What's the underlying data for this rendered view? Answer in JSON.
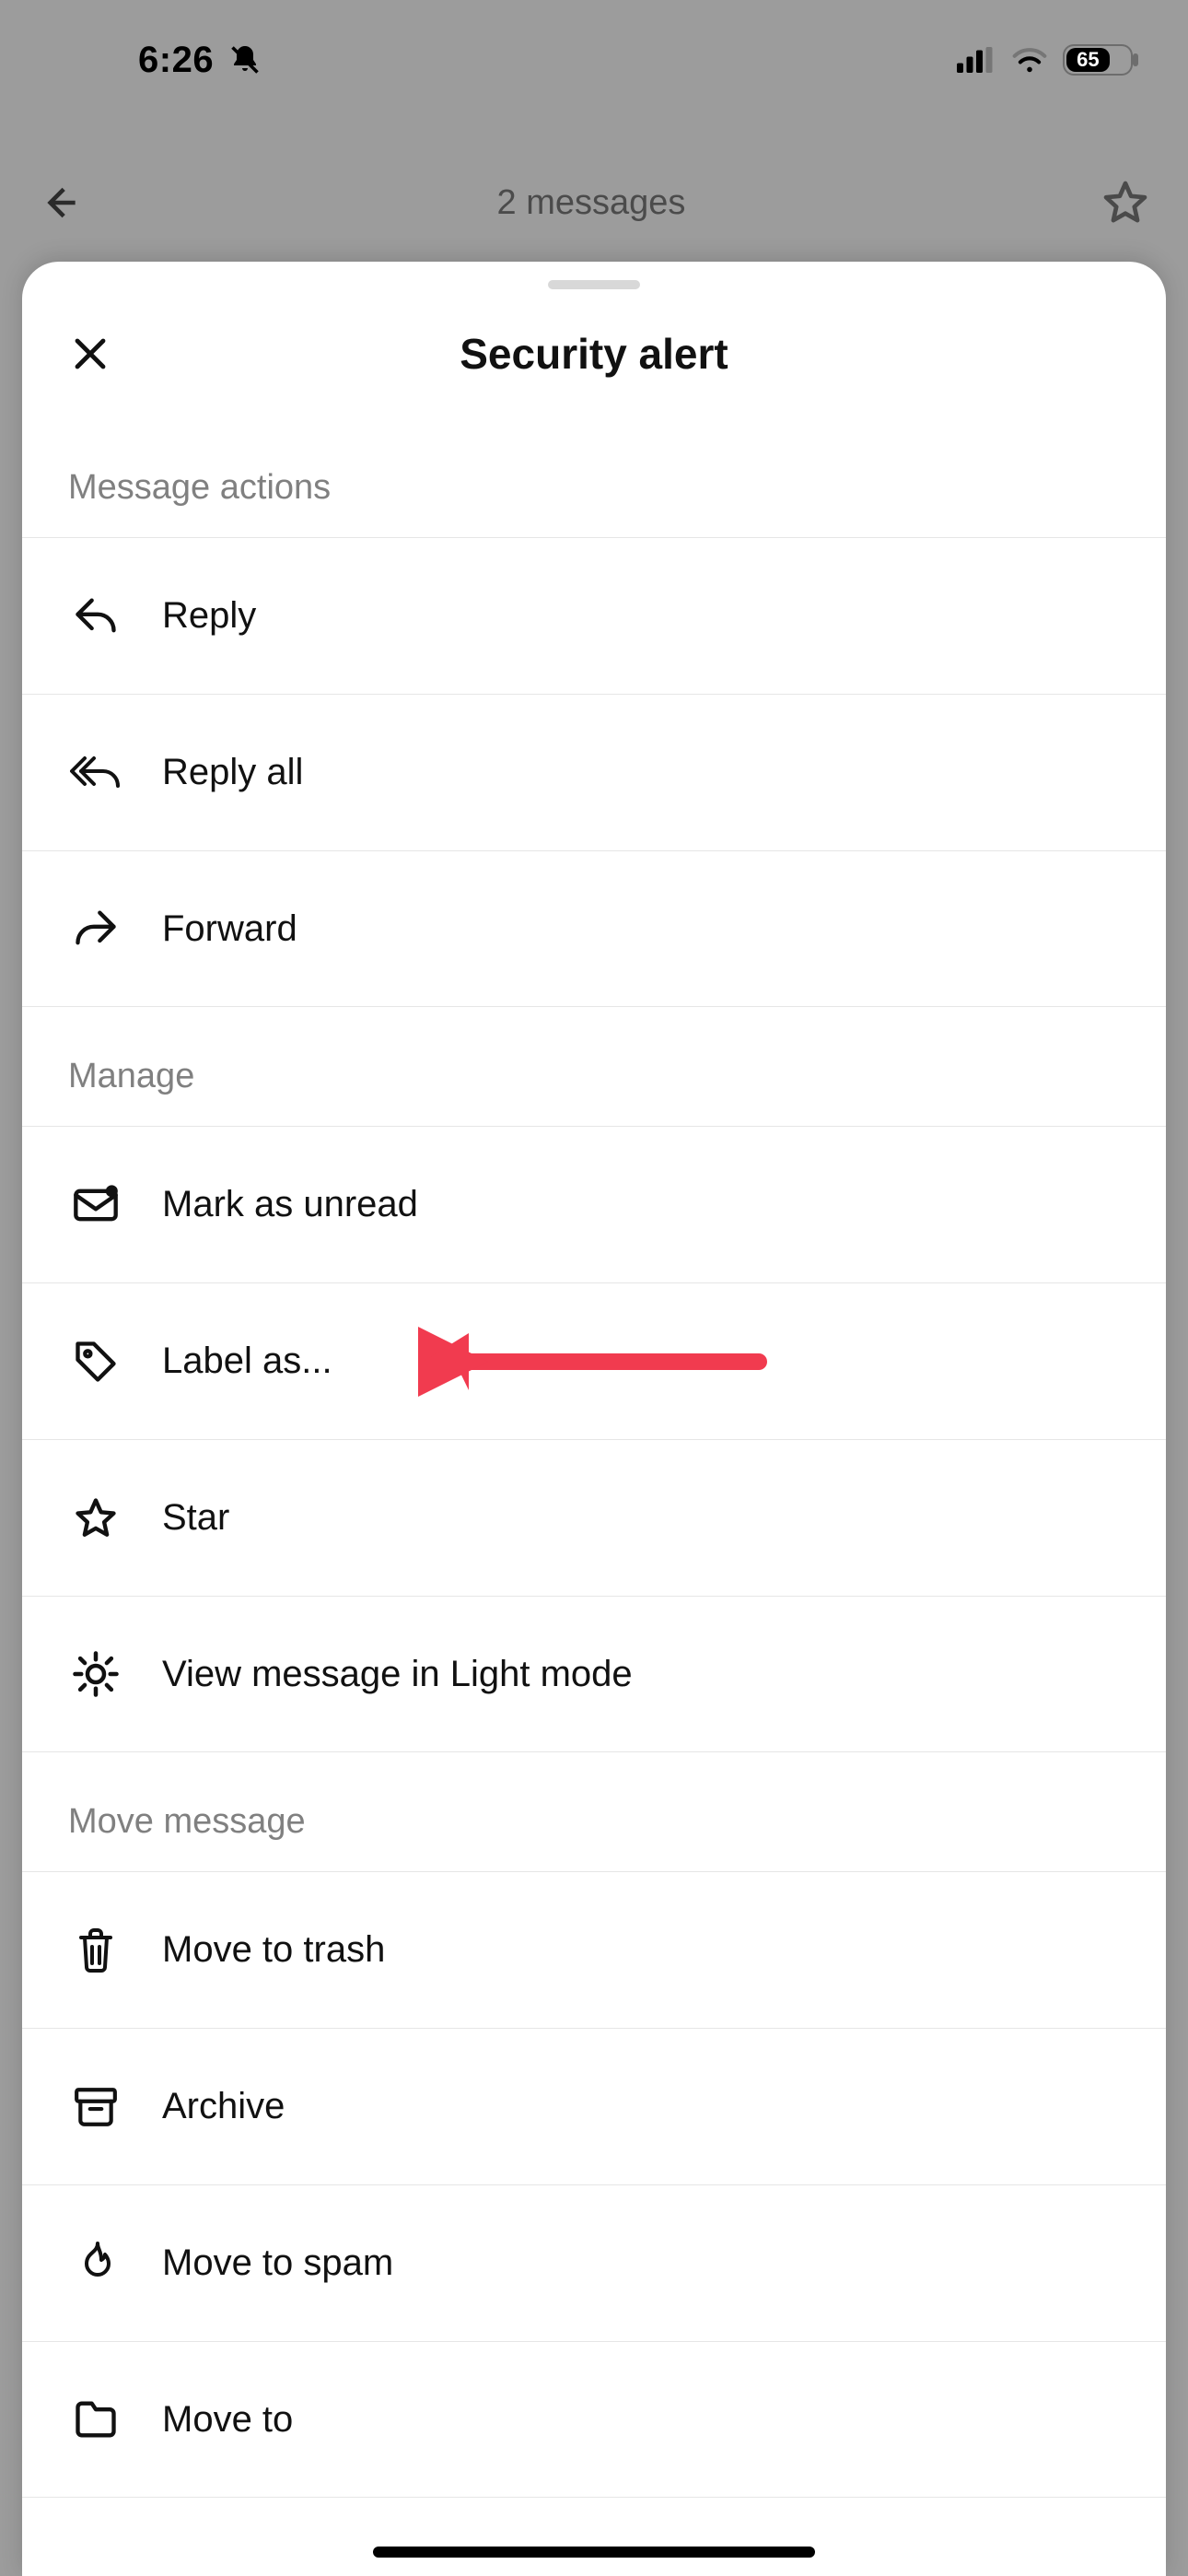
{
  "status_bar": {
    "time": "6:26",
    "battery_percent": "65"
  },
  "nav": {
    "title": "2 messages"
  },
  "sheet": {
    "title": "Security alert",
    "sections": {
      "message_actions": {
        "label": "Message actions",
        "reply": "Reply",
        "reply_all": "Reply all",
        "forward": "Forward"
      },
      "manage": {
        "label": "Manage",
        "mark_unread": "Mark as unread",
        "label_as": "Label as...",
        "star": "Star",
        "light_mode": "View message in Light mode"
      },
      "move": {
        "label": "Move message",
        "trash": "Move to trash",
        "archive": "Archive",
        "spam": "Move to spam",
        "move_to": "Move to"
      }
    }
  }
}
